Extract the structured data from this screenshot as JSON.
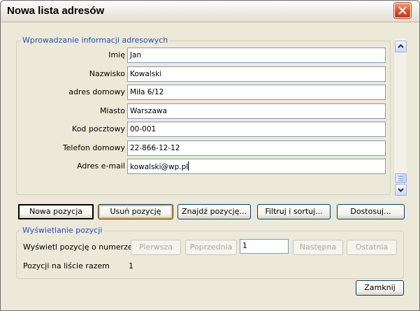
{
  "window": {
    "title": "Nowa lista adresów"
  },
  "entry_group": {
    "legend": "Wprowadzanie informacji adresowych",
    "fields": [
      {
        "label": "Imię",
        "value": "Jan"
      },
      {
        "label": "Nazwisko",
        "value": "Kowalski"
      },
      {
        "label": "adres domowy",
        "value": "Miła 6/12"
      },
      {
        "label": "Miasto",
        "value": "Warszawa"
      },
      {
        "label": "Kod pocztowy",
        "value": "00-001"
      },
      {
        "label": "Telefon domowy",
        "value": "22-866-12-12"
      },
      {
        "label": "Adres e-mail",
        "value": "kowalski@wp.pl"
      }
    ]
  },
  "actions": {
    "new_entry": "Nowa pozycja",
    "delete_entry": "Usuń pozycję",
    "find_entry": "Znajdź pozycję...",
    "filter_sort": "Filtruj i sortuj...",
    "customize": "Dostosuj..."
  },
  "view_group": {
    "legend": "Wyświetlanie pozycji",
    "show_entry_label": "Wyświetl pozycję o numerze",
    "first": "Pierwsza",
    "previous": "Poprzednia",
    "entry_number": "1",
    "next": "Następna",
    "last": "Ostatnia",
    "total_label": "Pozycji na liście razem",
    "total_value": "1"
  },
  "footer": {
    "close": "Zamknij"
  }
}
